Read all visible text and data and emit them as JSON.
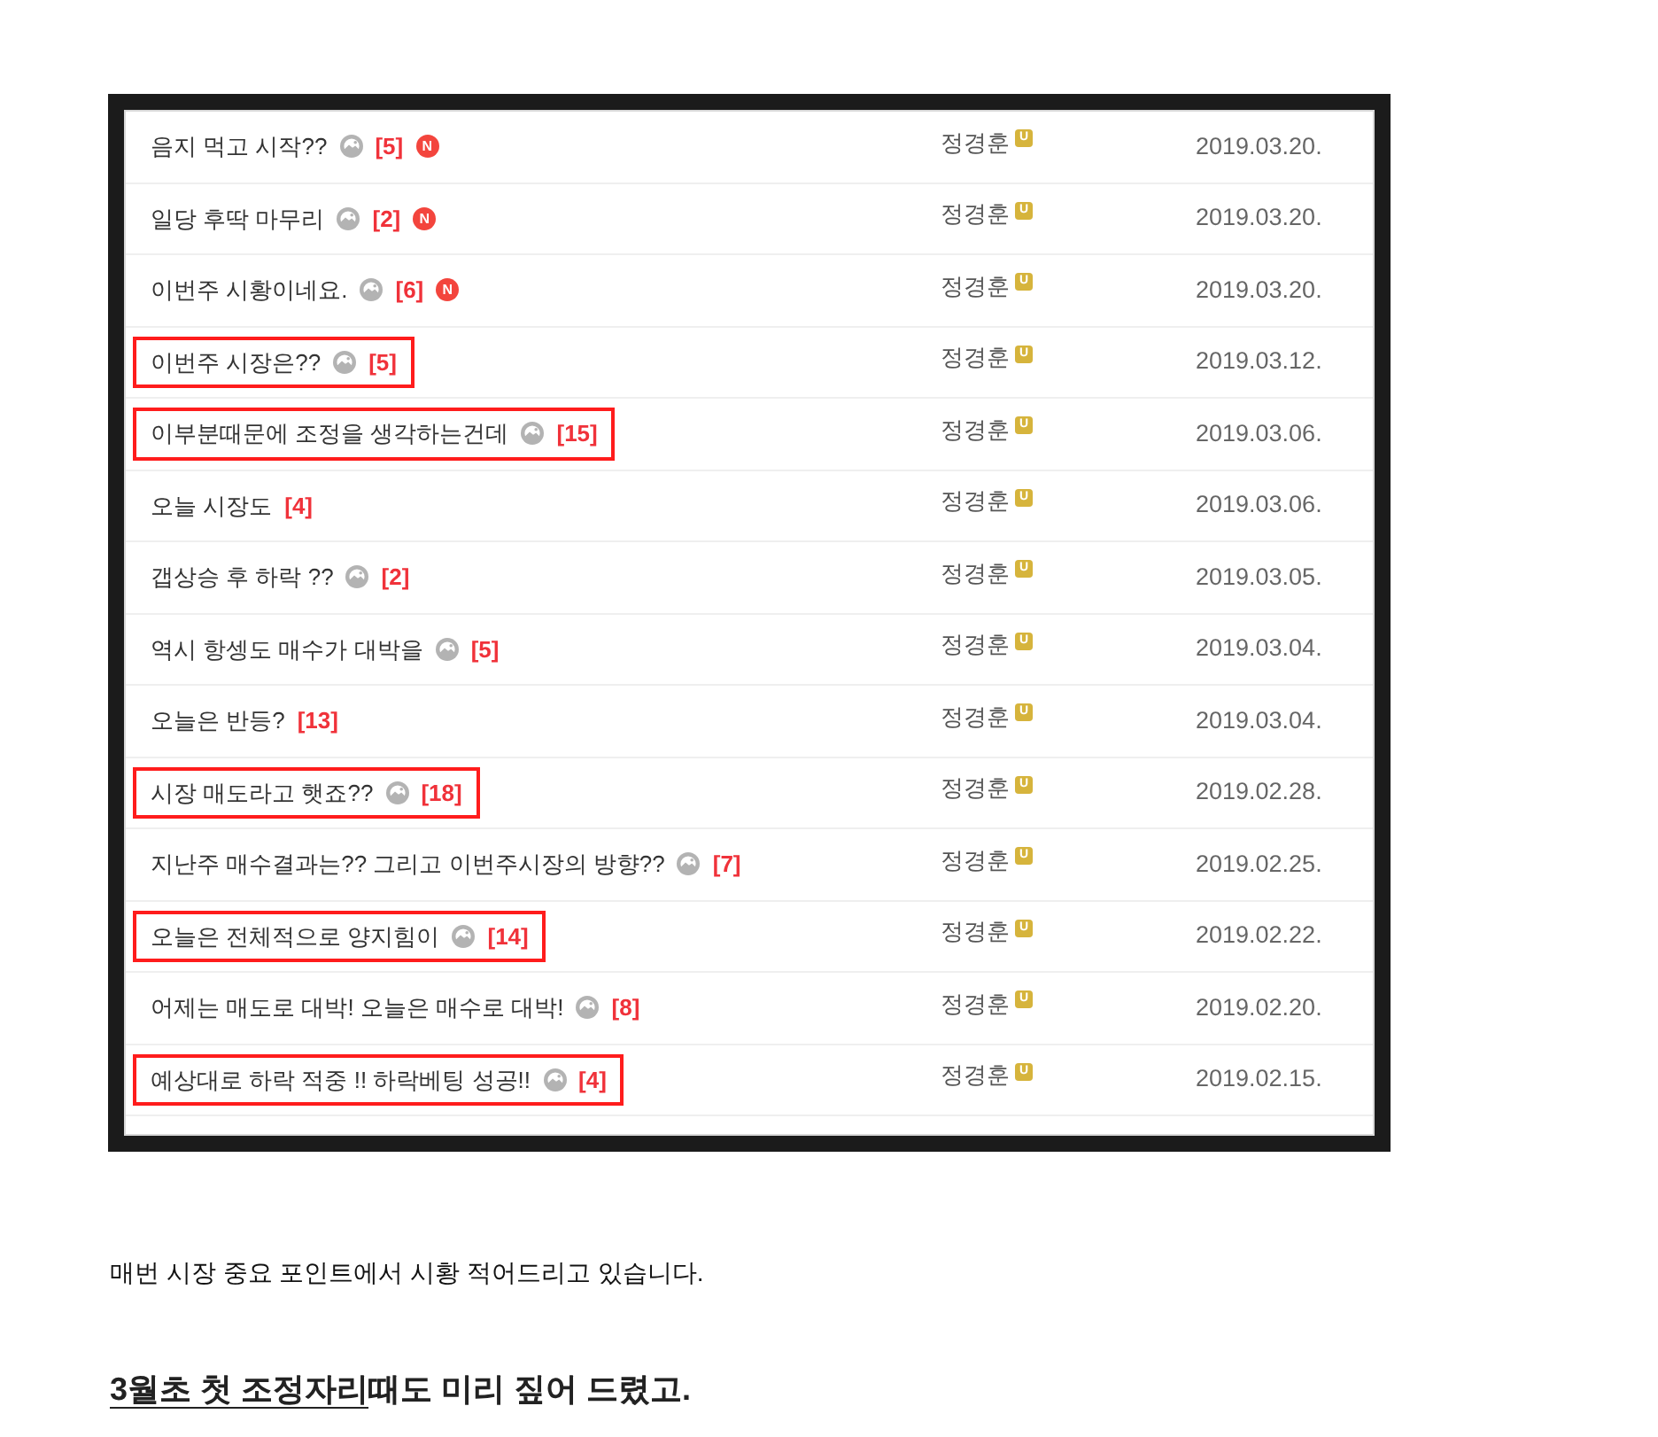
{
  "post_list": {
    "rows": [
      {
        "title": "음지 먹고 시작??",
        "has_image": true,
        "comments": "[5]",
        "new_badge": "N",
        "highlighted": false,
        "author": "정경훈",
        "author_badge": "U",
        "date": "2019.03.20."
      },
      {
        "title": "일당 후딱 마무리",
        "has_image": true,
        "comments": "[2]",
        "new_badge": "N",
        "highlighted": false,
        "author": "정경훈",
        "author_badge": "U",
        "date": "2019.03.20."
      },
      {
        "title": "이번주 시황이네요.",
        "has_image": true,
        "comments": "[6]",
        "new_badge": "N",
        "highlighted": false,
        "author": "정경훈",
        "author_badge": "U",
        "date": "2019.03.20."
      },
      {
        "title": "이번주 시장은??",
        "has_image": true,
        "comments": "[5]",
        "highlighted": true,
        "author": "정경훈",
        "author_badge": "U",
        "date": "2019.03.12."
      },
      {
        "title": "이부분때문에 조정을 생각하는건데",
        "has_image": true,
        "comments": "[15]",
        "highlighted": true,
        "author": "정경훈",
        "author_badge": "U",
        "date": "2019.03.06."
      },
      {
        "title": "오늘 시장도",
        "has_image": false,
        "comments": "[4]",
        "highlighted": false,
        "author": "정경훈",
        "author_badge": "U",
        "date": "2019.03.06."
      },
      {
        "title": "갭상승 후 하락 ??",
        "has_image": true,
        "comments": "[2]",
        "highlighted": false,
        "author": "정경훈",
        "author_badge": "U",
        "date": "2019.03.05."
      },
      {
        "title": "역시 항셍도 매수가 대박을",
        "has_image": true,
        "comments": "[5]",
        "highlighted": false,
        "author": "정경훈",
        "author_badge": "U",
        "date": "2019.03.04."
      },
      {
        "title": "오늘은 반등?",
        "has_image": false,
        "comments": "[13]",
        "highlighted": false,
        "author": "정경훈",
        "author_badge": "U",
        "date": "2019.03.04."
      },
      {
        "title": "시장 매도라고 햇죠??",
        "has_image": true,
        "comments": "[18]",
        "highlighted": true,
        "author": "정경훈",
        "author_badge": "U",
        "date": "2019.02.28."
      },
      {
        "title": "지난주 매수결과는?? 그리고 이번주시장의 방향??",
        "has_image": true,
        "comments": "[7]",
        "highlighted": false,
        "author": "정경훈",
        "author_badge": "U",
        "date": "2019.02.25."
      },
      {
        "title": "오늘은 전체적으로 양지힘이",
        "has_image": true,
        "comments": "[14]",
        "highlighted": true,
        "author": "정경훈",
        "author_badge": "U",
        "date": "2019.02.22."
      },
      {
        "title": "어제는 매도로 대박! 오늘은 매수로 대박!",
        "has_image": true,
        "comments": "[8]",
        "highlighted": false,
        "author": "정경훈",
        "author_badge": "U",
        "date": "2019.02.20."
      },
      {
        "title": "예상대로 하락 적중 !! 하락베팅 성공!!",
        "has_image": true,
        "comments": "[4]",
        "highlighted": true,
        "author": "정경훈",
        "author_badge": "U",
        "date": "2019.02.15."
      }
    ]
  },
  "body": {
    "paragraph": "매번 시장 중요 포인트에서 시황 적어드리고 있습니다.",
    "heading": [
      {
        "text": "3월초 첫 조정자리",
        "underlined": true
      },
      {
        "text": "때도 미리 짚어 드렸고.",
        "underlined": false
      }
    ]
  }
}
